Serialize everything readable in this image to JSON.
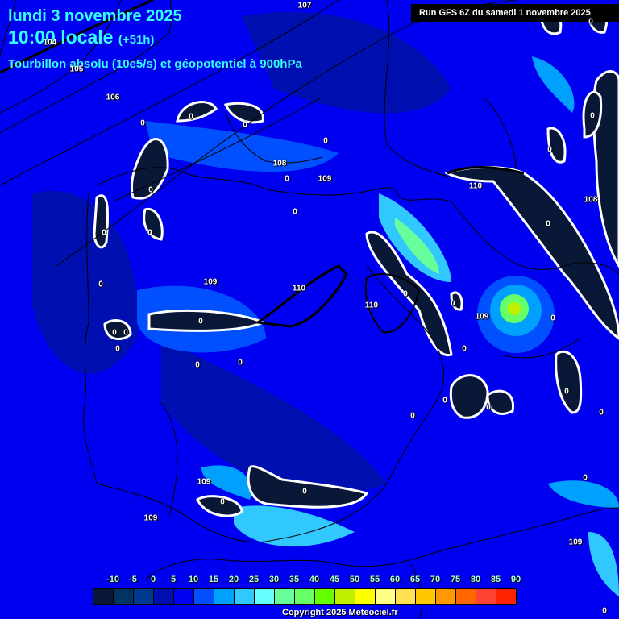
{
  "header": {
    "date": "lundi 3 novembre 2025",
    "time": "10:00 locale",
    "lead": "(+51h)",
    "parameter": "Tourbillon absolu (10e5/s) et géopotentiel à 900hPa",
    "run": "Run GFS 6Z du samedi 1 novembre 2025"
  },
  "geopotential_labels": [
    "107",
    "104",
    "105",
    "106",
    "108",
    "109",
    "109",
    "110",
    "110",
    "110",
    "109",
    "108",
    "109",
    "109",
    "109"
  ],
  "vorticity_zero_label": "0",
  "legend": {
    "ticks": [
      "-10",
      "-5",
      "0",
      "5",
      "10",
      "15",
      "20",
      "25",
      "30",
      "35",
      "40",
      "45",
      "50",
      "55",
      "60",
      "65",
      "70",
      "75",
      "80",
      "85",
      "90"
    ],
    "colors": [
      "#0a1838",
      "#003462",
      "#003a90",
      "#0010b0",
      "#0000f0",
      "#0050ff",
      "#00a0ff",
      "#30c8ff",
      "#66ffff",
      "#66ff99",
      "#66ff66",
      "#66ff00",
      "#c0f000",
      "#ffff00",
      "#ffff88",
      "#ffe050",
      "#ffc800",
      "#ff9900",
      "#ff6600",
      "#ff4433",
      "#ff2200"
    ]
  },
  "copyright": "Copyright 2025 Meteociel.fr"
}
